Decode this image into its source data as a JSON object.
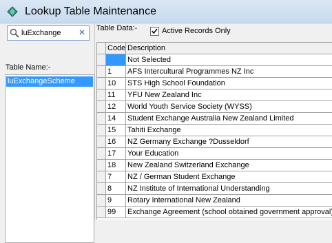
{
  "window": {
    "title": "Lookup Table Maintenance"
  },
  "search": {
    "value": "luExchange"
  },
  "labels": {
    "table_name": "Table Name:-",
    "table_data": "Table Data:-",
    "active_records": "Active Records Only"
  },
  "active_records_checked": true,
  "table_names": [
    "luExchangeScheme"
  ],
  "grid": {
    "columns": [
      "Code",
      "Description"
    ],
    "rows": [
      {
        "code": "",
        "desc": "Not Selected"
      },
      {
        "code": "1",
        "desc": "AFS Intercultural Programmes NZ Inc"
      },
      {
        "code": "10",
        "desc": "STS High School Foundation"
      },
      {
        "code": "11",
        "desc": "YFU New Zealand Inc"
      },
      {
        "code": "12",
        "desc": "World Youth Service Society (WYSS)"
      },
      {
        "code": "14",
        "desc": "Student Exchange Australia New Zealand Limited"
      },
      {
        "code": "15",
        "desc": "Tahiti Exchange"
      },
      {
        "code": "16",
        "desc": "NZ Germany Exchange ?Dusseldorf"
      },
      {
        "code": "17",
        "desc": "Your Education"
      },
      {
        "code": "18",
        "desc": "New Zealand Switzerland Exchange"
      },
      {
        "code": "7",
        "desc": "NZ / German Student Exchange"
      },
      {
        "code": "8",
        "desc": "NZ Institute of International Understanding"
      },
      {
        "code": "9",
        "desc": "Rotary International New Zealand"
      },
      {
        "code": "99",
        "desc": "Exchange Agreement (school obtained government approval)"
      }
    ]
  },
  "colors": {
    "selection": "#3399ff",
    "titlebar": "#d9e6f4"
  }
}
